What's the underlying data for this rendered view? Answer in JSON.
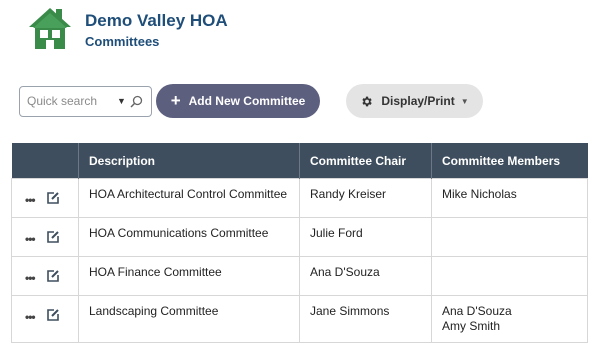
{
  "header": {
    "org_name": "Demo Valley HOA",
    "page_title": "Committees"
  },
  "toolbar": {
    "search_placeholder": "Quick search",
    "add_label": "Add New Committee",
    "display_label": "Display/Print"
  },
  "table": {
    "columns": [
      "Description",
      "Committee Chair",
      "Committee Members"
    ],
    "rows": [
      {
        "description": "HOA Architectural Control Committee",
        "chair": "Randy Kreiser",
        "members": [
          "Mike Nicholas"
        ]
      },
      {
        "description": "HOA Communications Committee",
        "chair": "Julie Ford",
        "members": []
      },
      {
        "description": "HOA Finance Committee",
        "chair": "Ana D'Souza",
        "members": []
      },
      {
        "description": "Landscaping Committee",
        "chair": "Jane Simmons",
        "members": [
          "Ana D'Souza",
          "Amy Smith"
        ]
      }
    ]
  },
  "colors": {
    "brand_green": "#3a8a4a",
    "title_blue": "#1f4e79",
    "header_bg": "#3e4e5e",
    "add_button_bg": "#5d5f7f",
    "display_button_bg": "#e4e4e4"
  }
}
